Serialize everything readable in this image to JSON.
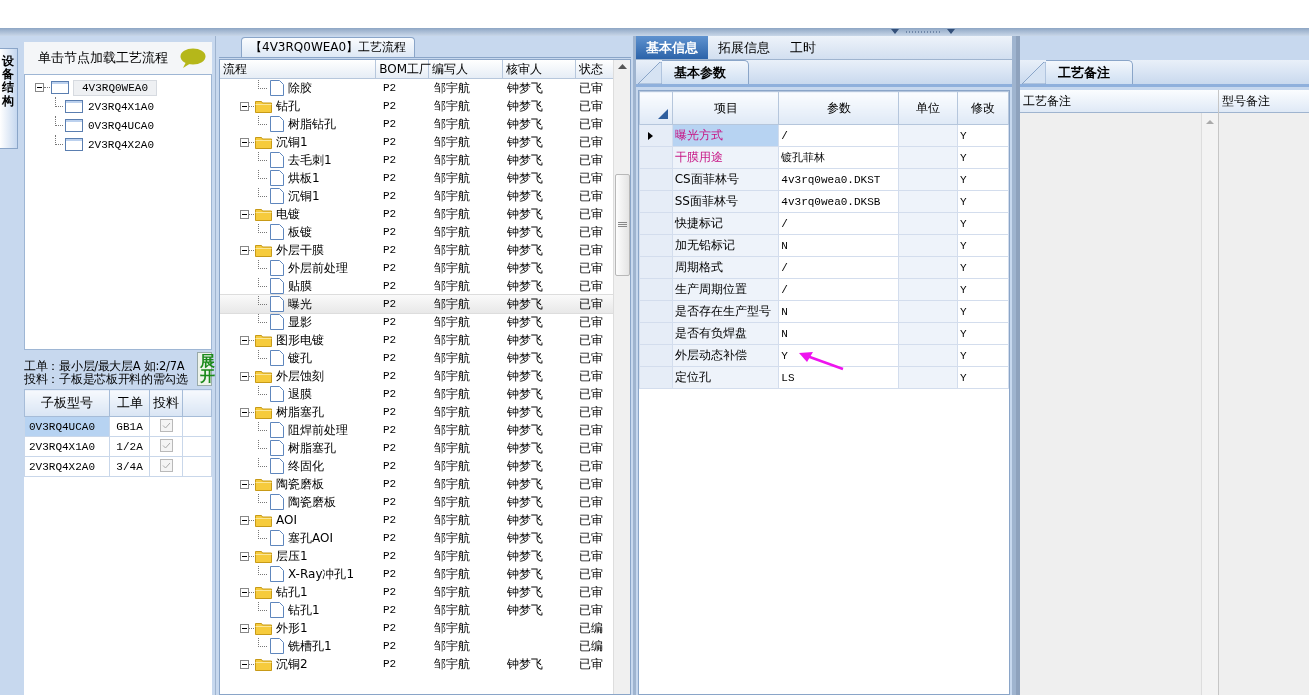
{
  "left_panel": {
    "side_tab": "设备结构",
    "header": "单击节点加载工艺流程",
    "tree": [
      {
        "label": "4V3RQ0WEA0",
        "expanded": true,
        "selected": true,
        "children": [
          {
            "label": "2V3RQ4X1A0",
            "selected": false
          },
          {
            "label": "0V3RQ4UCA0",
            "selected": false
          },
          {
            "label": "2V3RQ4X2A0",
            "selected": false
          }
        ]
      }
    ],
    "note_lines": [
      "工单：最小层/最大层A 如:2/7A",
      "投料：子板是芯板开料的需勾选"
    ],
    "expand_button": "展开",
    "sub_table": {
      "columns": [
        "子板型号",
        "工单",
        "投料"
      ],
      "rows": [
        {
          "model": "0V3RQ4UCA0",
          "order": "GB1A",
          "feed": true,
          "selected": true
        },
        {
          "model": "2V3RQ4X1A0",
          "order": "1/2A",
          "feed": true,
          "selected": false
        },
        {
          "model": "2V3RQ4X2A0",
          "order": "3/4A",
          "feed": true,
          "selected": false
        }
      ]
    }
  },
  "flow_panel": {
    "title": "【4V3RQ0WEA0】工艺流程",
    "columns": [
      "流程",
      "BOM工厂",
      "编写人",
      "核审人",
      "状态"
    ],
    "rows": [
      {
        "kind": "file",
        "name": "除胶",
        "bom": "P2",
        "writer": "邹宇航",
        "reviewer": "钟梦飞",
        "status": "已审",
        "selected": false
      },
      {
        "kind": "folder",
        "name": "钻孔",
        "bom": "P2",
        "writer": "邹宇航",
        "reviewer": "钟梦飞",
        "status": "已审",
        "selected": false,
        "expanded": true,
        "children": [
          {
            "kind": "file",
            "name": "树脂钻孔",
            "bom": "P2",
            "writer": "邹宇航",
            "reviewer": "钟梦飞",
            "status": "已审",
            "selected": false
          }
        ]
      },
      {
        "kind": "folder",
        "name": "沉铜1",
        "bom": "P2",
        "writer": "邹宇航",
        "reviewer": "钟梦飞",
        "status": "已审",
        "selected": false,
        "expanded": true,
        "children": [
          {
            "kind": "file",
            "name": "去毛刺1",
            "bom": "P2",
            "writer": "邹宇航",
            "reviewer": "钟梦飞",
            "status": "已审",
            "selected": false
          },
          {
            "kind": "file",
            "name": "烘板1",
            "bom": "P2",
            "writer": "邹宇航",
            "reviewer": "钟梦飞",
            "status": "已审",
            "selected": false
          },
          {
            "kind": "file",
            "name": "沉铜1",
            "bom": "P2",
            "writer": "邹宇航",
            "reviewer": "钟梦飞",
            "status": "已审",
            "selected": false
          }
        ]
      },
      {
        "kind": "folder",
        "name": "电镀",
        "bom": "P2",
        "writer": "邹宇航",
        "reviewer": "钟梦飞",
        "status": "已审",
        "selected": false,
        "expanded": true,
        "children": [
          {
            "kind": "file",
            "name": "板镀",
            "bom": "P2",
            "writer": "邹宇航",
            "reviewer": "钟梦飞",
            "status": "已审",
            "selected": false
          }
        ]
      },
      {
        "kind": "folder",
        "name": "外层干膜",
        "bom": "P2",
        "writer": "邹宇航",
        "reviewer": "钟梦飞",
        "status": "已审",
        "selected": false,
        "expanded": true,
        "children": [
          {
            "kind": "file",
            "name": "外层前处理",
            "bom": "P2",
            "writer": "邹宇航",
            "reviewer": "钟梦飞",
            "status": "已审",
            "selected": false
          },
          {
            "kind": "file",
            "name": "贴膜",
            "bom": "P2",
            "writer": "邹宇航",
            "reviewer": "钟梦飞",
            "status": "已审",
            "selected": false
          },
          {
            "kind": "file",
            "name": "曝光",
            "bom": "P2",
            "writer": "邹宇航",
            "reviewer": "钟梦飞",
            "status": "已审",
            "selected": true
          },
          {
            "kind": "file",
            "name": "显影",
            "bom": "P2",
            "writer": "邹宇航",
            "reviewer": "钟梦飞",
            "status": "已审",
            "selected": false
          }
        ]
      },
      {
        "kind": "folder",
        "name": "图形电镀",
        "bom": "P2",
        "writer": "邹宇航",
        "reviewer": "钟梦飞",
        "status": "已审",
        "selected": false,
        "expanded": true,
        "children": [
          {
            "kind": "file",
            "name": "镀孔",
            "bom": "P2",
            "writer": "邹宇航",
            "reviewer": "钟梦飞",
            "status": "已审",
            "selected": false
          }
        ]
      },
      {
        "kind": "folder",
        "name": "外层蚀刻",
        "bom": "P2",
        "writer": "邹宇航",
        "reviewer": "钟梦飞",
        "status": "已审",
        "selected": false,
        "expanded": true,
        "children": [
          {
            "kind": "file",
            "name": "退膜",
            "bom": "P2",
            "writer": "邹宇航",
            "reviewer": "钟梦飞",
            "status": "已审",
            "selected": false
          }
        ]
      },
      {
        "kind": "folder",
        "name": "树脂塞孔",
        "bom": "P2",
        "writer": "邹宇航",
        "reviewer": "钟梦飞",
        "status": "已审",
        "selected": false,
        "expanded": true,
        "children": [
          {
            "kind": "file",
            "name": "阻焊前处理",
            "bom": "P2",
            "writer": "邹宇航",
            "reviewer": "钟梦飞",
            "status": "已审",
            "selected": false
          },
          {
            "kind": "file",
            "name": "树脂塞孔",
            "bom": "P2",
            "writer": "邹宇航",
            "reviewer": "钟梦飞",
            "status": "已审",
            "selected": false
          },
          {
            "kind": "file",
            "name": "终固化",
            "bom": "P2",
            "writer": "邹宇航",
            "reviewer": "钟梦飞",
            "status": "已审",
            "selected": false
          }
        ]
      },
      {
        "kind": "folder",
        "name": "陶瓷磨板",
        "bom": "P2",
        "writer": "邹宇航",
        "reviewer": "钟梦飞",
        "status": "已审",
        "selected": false,
        "expanded": true,
        "children": [
          {
            "kind": "file",
            "name": "陶瓷磨板",
            "bom": "P2",
            "writer": "邹宇航",
            "reviewer": "钟梦飞",
            "status": "已审",
            "selected": false
          }
        ]
      },
      {
        "kind": "folder",
        "name": "AOI",
        "bom": "P2",
        "writer": "邹宇航",
        "reviewer": "钟梦飞",
        "status": "已审",
        "selected": false,
        "expanded": true,
        "children": [
          {
            "kind": "file",
            "name": "塞孔AOI",
            "bom": "P2",
            "writer": "邹宇航",
            "reviewer": "钟梦飞",
            "status": "已审",
            "selected": false
          }
        ]
      },
      {
        "kind": "folder",
        "name": "层压1",
        "bom": "P2",
        "writer": "邹宇航",
        "reviewer": "钟梦飞",
        "status": "已审",
        "selected": false,
        "expanded": true,
        "children": [
          {
            "kind": "file",
            "name": "X-Ray冲孔1",
            "bom": "P2",
            "writer": "邹宇航",
            "reviewer": "钟梦飞",
            "status": "已审",
            "selected": false
          }
        ]
      },
      {
        "kind": "folder",
        "name": "钻孔1",
        "bom": "P2",
        "writer": "邹宇航",
        "reviewer": "钟梦飞",
        "status": "已审",
        "selected": false,
        "expanded": true,
        "children": [
          {
            "kind": "file",
            "name": "钻孔1",
            "bom": "P2",
            "writer": "邹宇航",
            "reviewer": "钟梦飞",
            "status": "已审",
            "selected": false
          }
        ]
      },
      {
        "kind": "folder",
        "name": "外形1",
        "bom": "P2",
        "writer": "邹宇航",
        "status": "已编",
        "selected": false,
        "expanded": true,
        "children": [
          {
            "kind": "file",
            "name": "铣槽孔1",
            "bom": "P2",
            "writer": "邹宇航",
            "status": "已编",
            "selected": false
          }
        ]
      },
      {
        "kind": "folder",
        "name": "沉铜2",
        "bom": "P2",
        "writer": "邹宇航",
        "reviewer": "钟梦飞",
        "status": "已审",
        "selected": false,
        "expanded": true
      }
    ]
  },
  "info_panel": {
    "tabs": [
      {
        "label": "基本信息",
        "selected": true
      },
      {
        "label": "拓展信息",
        "selected": false
      },
      {
        "label": "工时",
        "selected": false
      }
    ],
    "subtab": "基本参数",
    "columns": [
      "项目",
      "参数",
      "单位",
      "修改"
    ],
    "rows": [
      {
        "item": "曝光方式",
        "value": "/",
        "modify": "Y",
        "emphasized": true,
        "selected": true
      },
      {
        "item": "干膜用途",
        "value": "镀孔菲林",
        "modify": "Y",
        "emphasized": true,
        "selected": false
      },
      {
        "item": "CS面菲林号",
        "value": "4v3rq0wea0.DKST",
        "modify": "Y",
        "emphasized": false,
        "selected": false
      },
      {
        "item": "SS面菲林号",
        "value": "4v3rq0wea0.DKSB",
        "modify": "Y",
        "emphasized": false,
        "selected": false
      },
      {
        "item": "快捷标记",
        "value": "/",
        "modify": "Y",
        "emphasized": false,
        "selected": false
      },
      {
        "item": "加无铅标记",
        "value": "N",
        "modify": "Y",
        "emphasized": false,
        "selected": false
      },
      {
        "item": "周期格式",
        "value": "/",
        "modify": "Y",
        "emphasized": false,
        "selected": false
      },
      {
        "item": "生产周期位置",
        "value": "/",
        "modify": "Y",
        "emphasized": false,
        "selected": false
      },
      {
        "item": "是否存在生产型号",
        "value": "N",
        "modify": "Y",
        "emphasized": false,
        "selected": false
      },
      {
        "item": "是否有负焊盘",
        "value": "N",
        "modify": "Y",
        "emphasized": false,
        "selected": false
      },
      {
        "item": "外层动态补偿",
        "value": "Y",
        "modify": "Y",
        "emphasized": false,
        "selected": false
      },
      {
        "item": "定位孔",
        "value": "LS",
        "modify": "Y",
        "emphasized": false,
        "selected": false
      }
    ]
  },
  "notes_panel": {
    "subtab": "工艺备注",
    "columns": [
      "工艺备注",
      "型号备注"
    ]
  }
}
